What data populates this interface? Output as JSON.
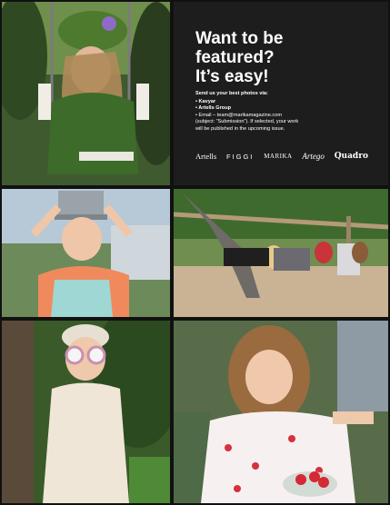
{
  "info": {
    "headline": [
      "Want to be",
      "featured?",
      "It’s easy!"
    ],
    "lead": "Send us your best photos via:",
    "items": [
      "• Kavyar",
      "• Artells Group",
      "• Email – team@marikamagazine.com",
      "(subject: “Submission”). If selected, your work",
      "will be published in the upcoming issue."
    ],
    "logos": [
      "Artells",
      "FIGGI",
      "MARIKA",
      "Artego",
      "Quadro"
    ]
  },
  "colors": {
    "panel": "#1d1d1d",
    "text": "#ffffff",
    "background": "#111111"
  }
}
